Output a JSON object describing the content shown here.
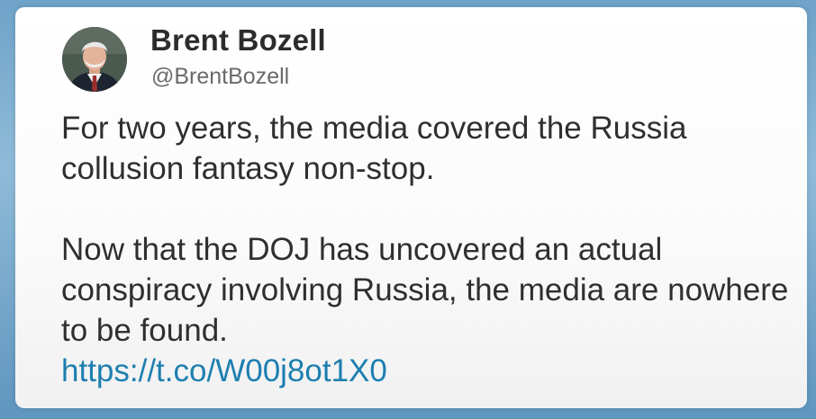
{
  "author": {
    "name": "Brent Bozell",
    "handle": "@BrentBozell",
    "avatar_icon": "profile-photo"
  },
  "tweet": {
    "paragraph1": "For two years, the media covered the Russia collusion fantasy non-stop.",
    "paragraph2": "Now that the DOJ has uncovered an actual conspiracy involving Russia, the media are nowhere to be found.",
    "link": "https://t.co/W00j8ot1X0"
  },
  "colors": {
    "link": "#1d7fb0",
    "text": "#2f2f2f",
    "handle": "#6a6a6a"
  }
}
